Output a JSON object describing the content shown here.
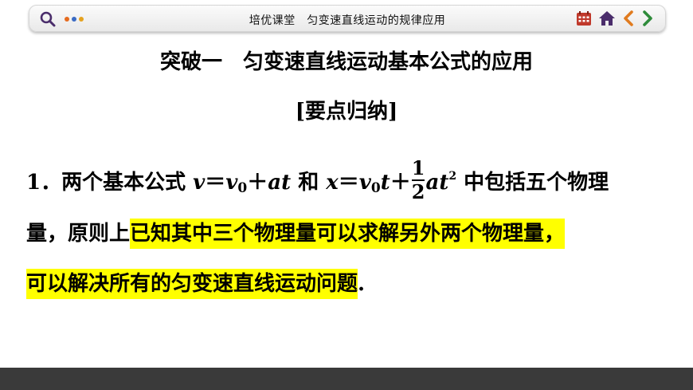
{
  "header": {
    "title": "培优课堂　匀变速直线运动的规律应用",
    "dot_colors": [
      "#e56b1f",
      "#3b6bc4",
      "#e5a21f"
    ],
    "icons": [
      "search-icon",
      "menu-dots-icon",
      "calendar-grid-icon",
      "home-icon",
      "chevron-left-icon",
      "chevron-right-icon"
    ]
  },
  "content": {
    "heading": "突破一　匀变速直线运动基本公式的应用",
    "subheading": "[要点归纳]",
    "paragraph": {
      "number": "1．",
      "intro": "两个基本公式",
      "formula1": {
        "v": "v",
        "eq": "＝",
        "v0": "v",
        "zero": "0",
        "plus": "＋",
        "at": "at"
      },
      "and": "和",
      "formula2": {
        "x": "x",
        "eq": "＝",
        "v0": "v",
        "zero": "0",
        "t": "t",
        "plus": "＋",
        "num": "1",
        "den": "2",
        "at": "at",
        "sq": "2"
      },
      "after": "中包括五个物理",
      "line2_start": "量，原则上",
      "highlight1": "已知其中三个物理量可以求解另外两个物理量，",
      "highlight2": "可以解决所有的匀变速直线运动问题",
      "end": ".",
      "highlight_color": "#ffff00"
    }
  }
}
